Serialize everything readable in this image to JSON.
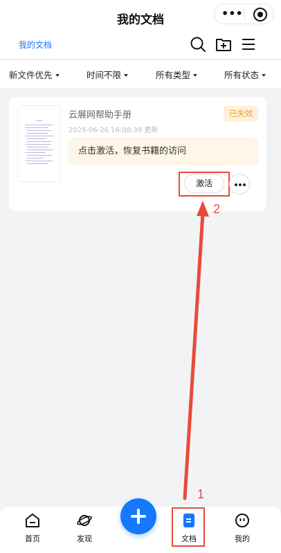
{
  "header": {
    "title": "我的文档",
    "capsule_more_glyph": "•••"
  },
  "toolbar": {
    "breadcrumb": "我的文档",
    "icons": [
      "search-icon",
      "new-folder-icon",
      "menu-icon"
    ]
  },
  "filters": [
    {
      "label": "新文件优先"
    },
    {
      "label": "时间不限"
    },
    {
      "label": "所有类型"
    },
    {
      "label": "所有状态"
    }
  ],
  "document": {
    "title": "云展网帮助手册",
    "updated": "2025-06-26 16:08:39 更新",
    "status_badge": "已失效",
    "notice": "点击激活，恢复书籍的访问",
    "activate_label": "激活"
  },
  "annotations": {
    "step1": "1",
    "step2": "2",
    "color": "#e84a3d"
  },
  "tabbar": {
    "items": [
      {
        "label": "首页",
        "icon": "home-icon"
      },
      {
        "label": "发现",
        "icon": "planet-icon"
      },
      {
        "label": "文档",
        "icon": "document-icon",
        "active": true
      },
      {
        "label": "我的",
        "icon": "profile-icon"
      }
    ],
    "fab_icon": "plus-icon",
    "accent": "#1677ff"
  }
}
